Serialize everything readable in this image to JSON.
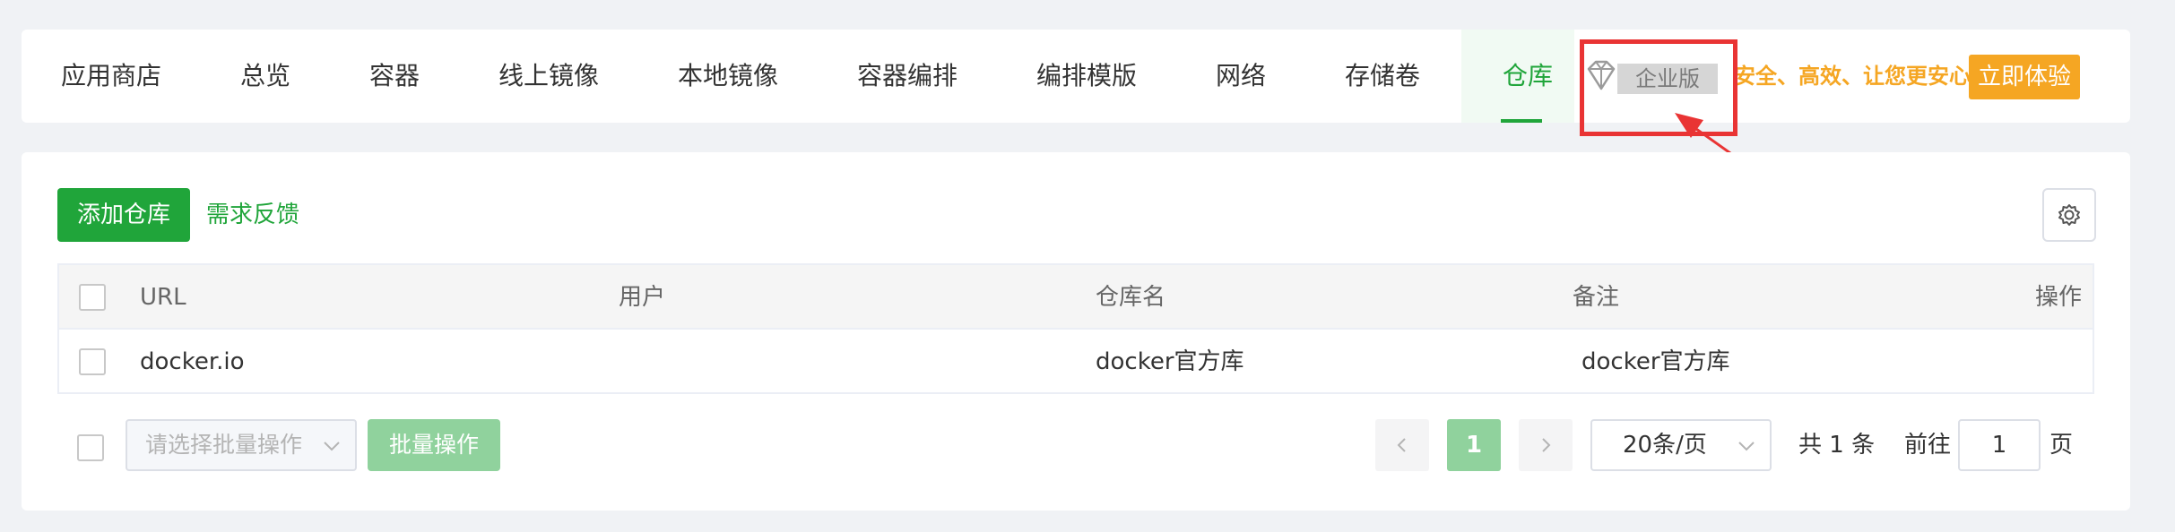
{
  "nav": {
    "tabs": [
      {
        "label": "应用商店"
      },
      {
        "label": "总览"
      },
      {
        "label": "容器"
      },
      {
        "label": "线上镜像"
      },
      {
        "label": "本地镜像"
      },
      {
        "label": "容器编排"
      },
      {
        "label": "编排模版"
      },
      {
        "label": "网络"
      },
      {
        "label": "存储卷"
      },
      {
        "label": "仓库"
      }
    ],
    "active_tab": "仓库",
    "enterprise_badge": "企业版",
    "slogan": "安全、高效、让您更安心",
    "try_button": "立即体验"
  },
  "toolbar": {
    "add_button": "添加仓库",
    "feedback_link": "需求反馈"
  },
  "table": {
    "columns": [
      "URL",
      "用户",
      "仓库名",
      "备注",
      "操作"
    ],
    "rows": [
      {
        "url": "docker.io",
        "user": "",
        "repo_name": "docker官方库",
        "remark": "docker官方库",
        "action": ""
      }
    ]
  },
  "footer": {
    "batch_select_placeholder": "请选择批量操作",
    "batch_button": "批量操作",
    "current_page": "1",
    "page_size": "20条/页",
    "total": "共 1 条",
    "goto_label": "前往",
    "goto_value": "1",
    "goto_suffix": "页"
  },
  "colors": {
    "accent": "#20a53a",
    "accent_light": "#90d29d",
    "enterprise": "#f5a623",
    "annotation": "#e93434"
  },
  "icons": [
    "diamond-icon",
    "gear-icon",
    "chevron-down-icon",
    "chevron-left-icon",
    "chevron-right-icon"
  ]
}
